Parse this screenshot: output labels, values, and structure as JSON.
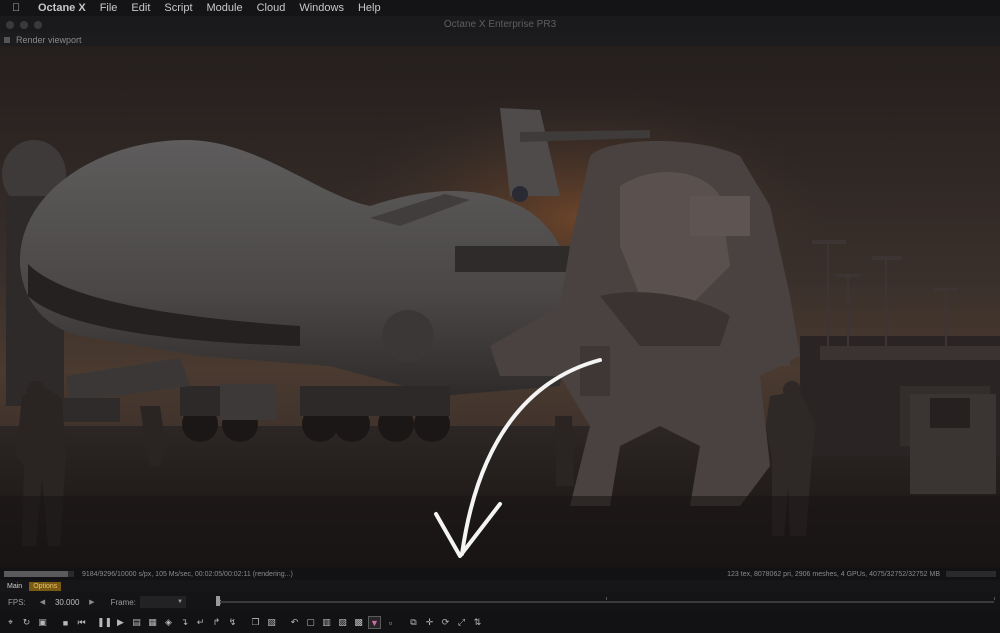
{
  "menubar": {
    "apple_icon": "apple-logo-icon",
    "items": [
      "Octane X",
      "File",
      "Edit",
      "Script",
      "Module",
      "Cloud",
      "Windows",
      "Help"
    ]
  },
  "window": {
    "title": "Octane X Enterprise PR3"
  },
  "panel": {
    "title": "Render viewport"
  },
  "status": {
    "left": "9184/9296/10000 s/px, 105 Ms/sec, 00:02:05/00:02:11 (rendering...)",
    "right": "123 tex, 8078062 pri, 2906 meshes, 4 GPUs, 4075/32752/32752 MB",
    "progress": 0.92
  },
  "tabs": {
    "items": [
      "Main",
      "Options"
    ],
    "active_index": 1
  },
  "timeline": {
    "fps_label": "FPS:",
    "fps_value": "30.000",
    "frame_label": "Frame:",
    "frame_value": "0",
    "position": 0.0
  },
  "toolbar": {
    "icons": [
      "recenter-view-icon",
      "reset-camera-icon",
      "lock-icon",
      "stop-render-icon",
      "restart-render-icon",
      "pause-render-icon",
      "start-render-icon",
      "region-render-icon",
      "film-region-icon",
      "color-picker-icon",
      "pick-focus-icon",
      "pick-white-balance-icon",
      "pick-material-icon",
      "pick-object-icon",
      "copy-to-clipboard-icon",
      "save-render-icon",
      "undo-icon",
      "clay-mode-icon",
      "subsample-icon",
      "decal-wireframe-icon",
      "texture-icon",
      "color-channel-icon",
      "lock-resolution-icon",
      "zoom-icon",
      "move-icon",
      "rotate-icon",
      "fit-view-icon",
      "axis-gizmo-icon"
    ],
    "active_icon": "color-channel-icon"
  },
  "colors": {
    "tab_active_bg": "#7a5a12",
    "tab_active_text": "#e2c070",
    "stroke_annotation": "#f4f4f4"
  }
}
